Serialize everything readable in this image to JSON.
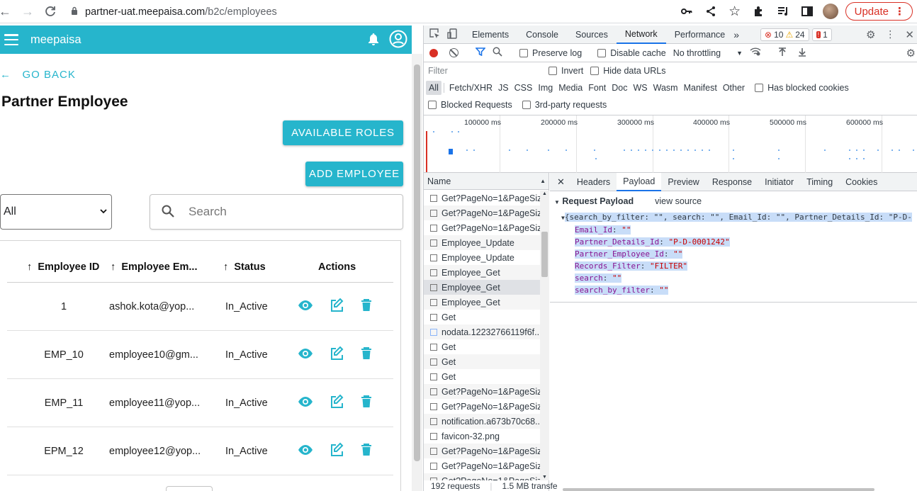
{
  "browser": {
    "url_host": "partner-uat.meepaisa.com",
    "url_path": "/b2c/employees",
    "update_label": "Update"
  },
  "app": {
    "brand": "meepaisa",
    "go_back": "GO BACK",
    "title": "Partner Employee",
    "available_roles": "AVAILABLE ROLES",
    "add_employee": "ADD EMPLOYEE",
    "filter_value": "All",
    "search_placeholder": "Search",
    "columns": [
      "Employee ID",
      "Employee Em...",
      "Status",
      "Actions"
    ],
    "rows": [
      {
        "id": "1",
        "email": "ashok.kota@yop...",
        "status": "In_Active"
      },
      {
        "id": "EMP_10",
        "email": "employee10@gm...",
        "status": "In_Active"
      },
      {
        "id": "EMP_11",
        "email": "employee11@yop...",
        "status": "In_Active"
      },
      {
        "id": "EPM_12",
        "email": "employee12@yop...",
        "status": "In_Active"
      }
    ]
  },
  "devtools": {
    "tabs": [
      "Elements",
      "Console",
      "Sources",
      "Network",
      "Performance"
    ],
    "active_tab": "Network",
    "errors": "10",
    "warnings": "24",
    "issues": "1",
    "preserve_log": "Preserve log",
    "disable_cache": "Disable cache",
    "throttling": "No throttling",
    "filter_placeholder": "Filter",
    "invert": "Invert",
    "hide_data_urls": "Hide data URLs",
    "types": [
      "All",
      "Fetch/XHR",
      "JS",
      "CSS",
      "Img",
      "Media",
      "Font",
      "Doc",
      "WS",
      "Wasm",
      "Manifest",
      "Other"
    ],
    "has_blocked_cookies": "Has blocked cookies",
    "blocked_requests": "Blocked Requests",
    "third_party": "3rd-party requests",
    "timeline_ticks": [
      "100000 ms",
      "200000 ms",
      "300000 ms",
      "400000 ms",
      "500000 ms",
      "600000 ms"
    ],
    "name_header": "Name",
    "requests": [
      "Get?PageNo=1&PageSiz...",
      "Get?PageNo=1&PageSiz...",
      "Get?PageNo=1&PageSiz...",
      "Employee_Update",
      "Employee_Update",
      "Employee_Get",
      "Employee_Get",
      "Employee_Get",
      "Get",
      "nodata.12232766119f6f...",
      "Get",
      "Get",
      "Get",
      "Get?PageNo=1&PageSiz...",
      "Get?PageNo=1&PageSiz...",
      "notification.a673b70c68...",
      "favicon-32.png",
      "Get?PageNo=1&PageSiz...",
      "Get?PageNo=1&PageSiz...",
      "Get?PageNo=1&PageSiz..."
    ],
    "status_requests": "192 requests",
    "status_transfer": "1.5 MB transfe",
    "detail_tabs": [
      "Headers",
      "Payload",
      "Preview",
      "Response",
      "Initiator",
      "Timing",
      "Cookies"
    ],
    "active_detail_tab": "Payload",
    "request_payload": "Request Payload",
    "view_source": "view source",
    "payload_summary": "{search_by_filter: \"\", search: \"\", Email_Id: \"\", Partner_Details_Id: \"P-D-",
    "payload": [
      {
        "key": "Email_Id",
        "value": "\"\""
      },
      {
        "key": "Partner_Details_Id",
        "value": "\"P-D-0001242\""
      },
      {
        "key": "Partner_Employee_Id",
        "value": "\"\""
      },
      {
        "key": "Records_Filter",
        "value": "\"FILTER\""
      },
      {
        "key": "search",
        "value": "\"\""
      },
      {
        "key": "search_by_filter",
        "value": "\"\""
      }
    ]
  }
}
